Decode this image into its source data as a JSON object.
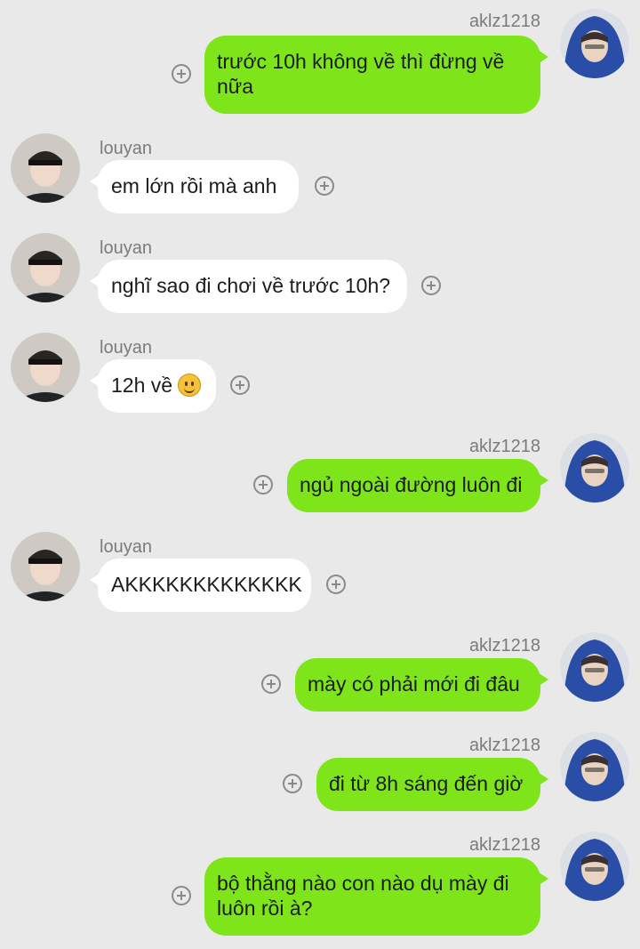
{
  "messages": [
    {
      "sender": "aklz1218",
      "text": "trước 10h không về thì đừng về nữa"
    },
    {
      "sender": "louyan",
      "text": "em lớn rồi mà anh"
    },
    {
      "sender": "louyan",
      "text": "nghĩ sao đi chơi về trước 10h?"
    },
    {
      "sender": "louyan",
      "text": "12h về",
      "emoji": "slightly-smiling-face-icon"
    },
    {
      "sender": "aklz1218",
      "text": "ngủ ngoài đường luôn đi"
    },
    {
      "sender": "louyan",
      "text": "AKKKKKKKKKKKKK"
    },
    {
      "sender": "aklz1218",
      "text": "mày có phải mới đi đâu"
    },
    {
      "sender": "aklz1218",
      "text": "đi từ 8h sáng đến giờ"
    },
    {
      "sender": "aklz1218",
      "text": "bộ thằng nào con nào dụ mày đi luôn rồi à?"
    }
  ],
  "icons": {
    "add_reaction": "plus-circle-icon",
    "avatar_me": "avatar-blue-hoodie",
    "avatar_them": "avatar-headband"
  },
  "colors": {
    "background": "#e9e9e9",
    "outgoing_bubble": "#7ee51a",
    "incoming_bubble": "#ffffff",
    "sender_name": "#7b7b7b"
  }
}
